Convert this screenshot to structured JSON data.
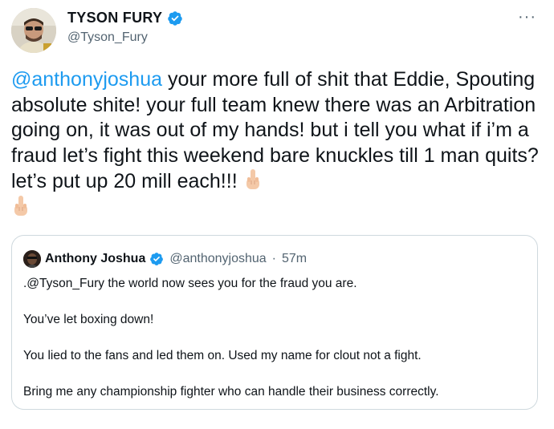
{
  "author": {
    "name": "TYSON FURY",
    "handle": "@Tyson_Fury"
  },
  "menu_icon": "more-horizontal-icon",
  "tweet": {
    "mention": "@anthonyjoshua",
    "text": " your more full of shit that Eddie, Spouting absolute shite! your full team knew there was an Arbitration going on, it was out of my hands! but i tell you what if i’m a fraud let’s fight this weekend bare knuckles till 1 man quits? let’s put up 20 mill each!!! ",
    "emojis": [
      "middle-finger-emoji",
      "middle-finger-emoji"
    ]
  },
  "quote": {
    "name": "Anthony Joshua",
    "handle": "@anthonyjoshua",
    "separator": "·",
    "time": "57m",
    "lines": [
      ".@Tyson_Fury the world now sees you for the fraud you are.",
      "You’ve let boxing down!",
      "You lied to the fans and led them on. Used my name for clout not a fight.",
      "Bring me any championship fighter who can handle their business correctly."
    ]
  },
  "colors": {
    "link": "#1d9bf0",
    "verified": "#1d9bf0",
    "secondary_text": "#536471",
    "border": "#cfd9de"
  }
}
